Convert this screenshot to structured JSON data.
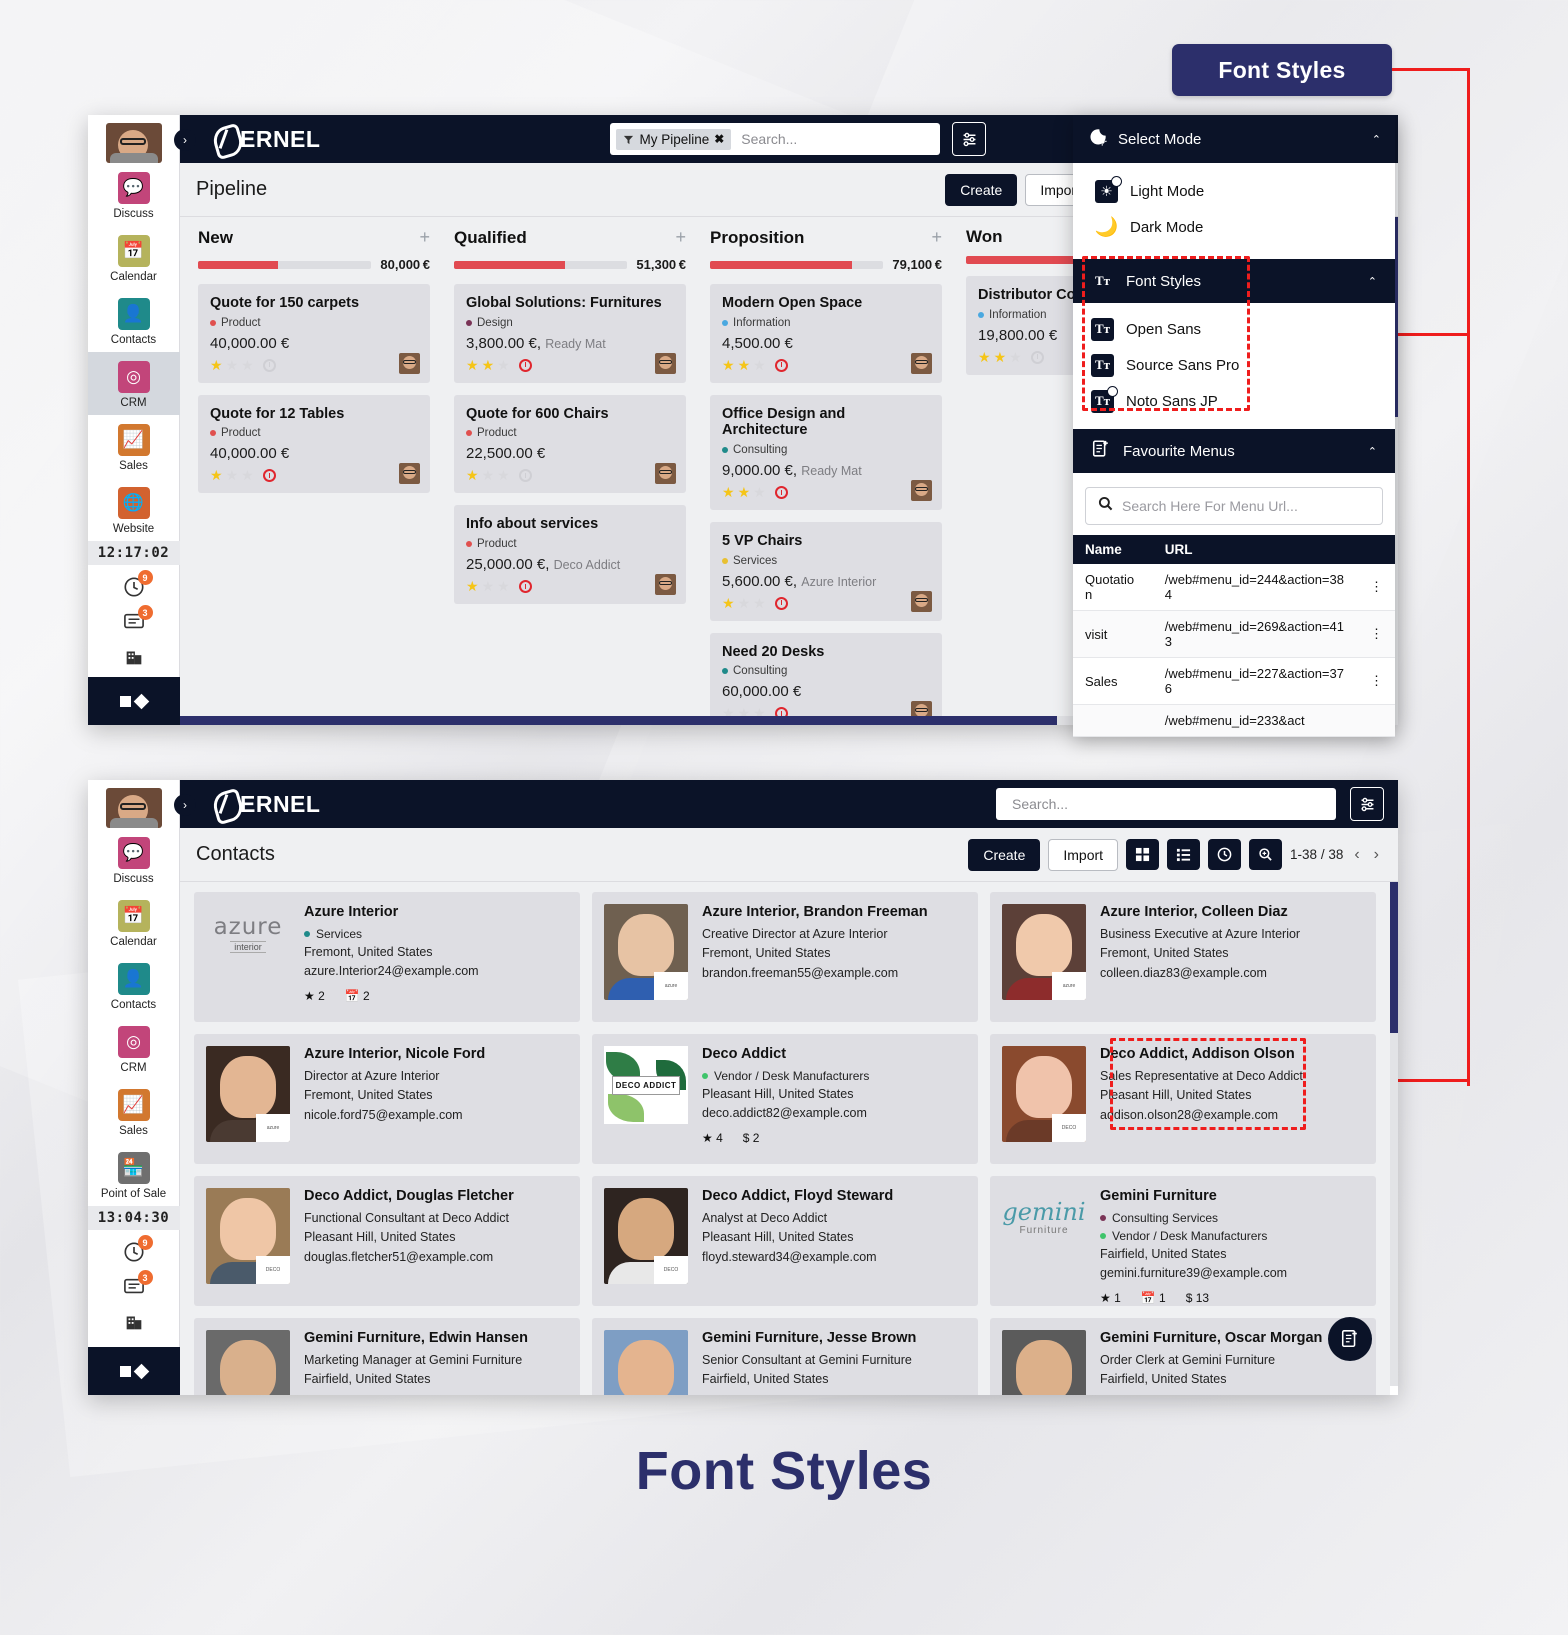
{
  "annotations": {
    "badge_label": "Font Styles",
    "bottom_caption": "Font Styles"
  },
  "window1": {
    "brand": "ERNEL",
    "page_title": "Pipeline",
    "search": {
      "facet": "My Pipeline",
      "facet_remove": "✖",
      "placeholder": "Search..."
    },
    "clock": "12:17:02",
    "buttons": {
      "create": "Create",
      "import": "Import"
    },
    "view_icons": [
      "kanban-view",
      "list-view",
      "calendar-view",
      "pivot-view",
      "graph-view",
      "activity-view",
      "map-view"
    ],
    "sidebar": [
      {
        "label": "Discuss",
        "color": "#c2457a",
        "glyph": "💬"
      },
      {
        "label": "Calendar",
        "color": "#b5b35c",
        "glyph": "📅"
      },
      {
        "label": "Contacts",
        "color": "#1f8a8a",
        "glyph": "👤"
      },
      {
        "label": "CRM",
        "color": "#c2457a",
        "glyph": "◎"
      },
      {
        "label": "Sales",
        "color": "#d2782f",
        "glyph": "📈"
      },
      {
        "label": "Website",
        "color": "#d2622f",
        "glyph": "🌐"
      }
    ],
    "badges": {
      "clock_count": "9",
      "chat_count": "3"
    },
    "columns": [
      {
        "name": "New",
        "amount": "80,000 €",
        "progress": 46,
        "cards": [
          {
            "title": "Quote for 150 carpets",
            "tag": "Product",
            "tag_color": "#e0504f",
            "amount": "40,000.00 €",
            "partner": "",
            "stars": 1,
            "clock": "mute"
          },
          {
            "title": "Quote for 12 Tables",
            "tag": "Product",
            "tag_color": "#e0504f",
            "amount": "40,000.00 €",
            "partner": "",
            "stars": 1,
            "clock": "red"
          }
        ]
      },
      {
        "name": "Qualified",
        "amount": "51,300 €",
        "progress": 64,
        "cards": [
          {
            "title": "Global Solutions: Furnitures",
            "tag": "Design",
            "tag_color": "#7a3356",
            "amount": "3,800.00 €",
            "partner": "Ready Mat",
            "stars": 2,
            "clock": "red"
          },
          {
            "title": "Quote for 600 Chairs",
            "tag": "Product",
            "tag_color": "#e0504f",
            "amount": "22,500.00 €",
            "partner": "",
            "stars": 1,
            "clock": "mute"
          },
          {
            "title": "Info about services",
            "tag": "Product",
            "tag_color": "#e0504f",
            "amount": "25,000.00 €",
            "partner": "Deco Addict",
            "stars": 1,
            "clock": "red"
          }
        ]
      },
      {
        "name": "Proposition",
        "amount": "79,100 €",
        "progress": 82,
        "cards": [
          {
            "title": "Modern Open Space",
            "tag": "Information",
            "tag_color": "#4aa8e0",
            "amount": "4,500.00 €",
            "partner": "",
            "stars": 2,
            "clock": "red"
          },
          {
            "title": "Office Design and Architecture",
            "tag": "Consulting",
            "tag_color": "#1f8a8a",
            "amount": "9,000.00 €",
            "partner": "Ready Mat",
            "stars": 2,
            "clock": "red"
          },
          {
            "title": "5 VP Chairs",
            "tag": "Services",
            "tag_color": "#e8c031",
            "amount": "5,600.00 €",
            "partner": "Azure Interior",
            "stars": 1,
            "clock": "red"
          },
          {
            "title": "Need 20 Desks",
            "tag": "Consulting",
            "tag_color": "#1f8a8a",
            "amount": "60,000.00 €",
            "partner": "",
            "stars": 0,
            "clock": "red"
          }
        ]
      },
      {
        "name": "Won",
        "amount": "",
        "progress": 100,
        "cards": [
          {
            "title": "Distributor Contract",
            "tag": "Information",
            "tag_color": "#4aa8e0",
            "amount": "19,800.00 €",
            "partner": "",
            "stars": 2,
            "clock": "mute"
          }
        ]
      }
    ]
  },
  "dropdown": {
    "header": {
      "label": "Select Mode",
      "caret": "⌃"
    },
    "mode_items": [
      {
        "label": "Light Mode",
        "icon": "sun-icon",
        "checked": true
      },
      {
        "label": "Dark Mode",
        "icon": "moon-icon",
        "checked": false
      }
    ],
    "font_section": {
      "label": "Font Styles",
      "caret": "⌃"
    },
    "fonts": [
      {
        "label": "Open Sans",
        "checked": false
      },
      {
        "label": "Source Sans Pro",
        "checked": false
      },
      {
        "label": "Noto Sans JP",
        "checked": true
      }
    ],
    "fav_section": {
      "label": "Favourite Menus",
      "caret": "⌃"
    },
    "fav_search_placeholder": "Search Here For Menu Url...",
    "fav_table": {
      "headers": [
        "Name",
        "URL"
      ],
      "rows": [
        {
          "name": "Quotation",
          "url": "/web#menu_id=244&action=384"
        },
        {
          "name": "visit",
          "url": "/web#menu_id=269&action=413"
        },
        {
          "name": "Sales",
          "url": "/web#menu_id=227&action=376"
        },
        {
          "name": "",
          "url": "/web#menu_id=233&act"
        }
      ]
    }
  },
  "window2": {
    "brand": "ERNEL",
    "page_title": "Contacts",
    "search": {
      "placeholder": "Search..."
    },
    "clock": "13:04:30",
    "buttons": {
      "create": "Create",
      "import": "Import"
    },
    "pager": "1-38 / 38",
    "sidebar": [
      {
        "label": "Discuss",
        "color": "#c2457a",
        "glyph": "💬"
      },
      {
        "label": "Calendar",
        "color": "#b5b35c",
        "glyph": "📅"
      },
      {
        "label": "Contacts",
        "color": "#1f8a8a",
        "glyph": "👤"
      },
      {
        "label": "CRM",
        "color": "#c2457a",
        "glyph": "◎"
      },
      {
        "label": "Sales",
        "color": "#d2782f",
        "glyph": "📈"
      },
      {
        "label": "Point of Sale",
        "color": "#6f6f6f",
        "glyph": "🏪"
      }
    ],
    "badges": {
      "clock_count": "9",
      "chat_count": "3"
    },
    "contacts": [
      {
        "name": "Azure Interior",
        "role": "",
        "tags": [
          {
            "text": "Services",
            "color": "#1f8a8a"
          }
        ],
        "city": "Fremont, United States",
        "email": "azure.Interior24@example.com",
        "stats": [
          {
            "icon": "star",
            "value": "2"
          },
          {
            "icon": "calendar",
            "value": "2"
          }
        ],
        "media": "azure-logo"
      },
      {
        "name": "Azure Interior, Brandon Freeman",
        "role": "Creative Director at Azure Interior",
        "tags": [],
        "city": "Fremont, United States",
        "email": "brandon.freeman55@example.com",
        "stats": [],
        "media": "photo-male-1"
      },
      {
        "name": "Azure Interior, Colleen Diaz",
        "role": "Business Executive at Azure Interior",
        "tags": [],
        "city": "Fremont, United States",
        "email": "colleen.diaz83@example.com",
        "stats": [],
        "media": "photo-female-1"
      },
      {
        "name": "Azure Interior, Nicole Ford",
        "role": "Director at Azure Interior",
        "tags": [],
        "city": "Fremont, United States",
        "email": "nicole.ford75@example.com",
        "stats": [],
        "media": "photo-female-2"
      },
      {
        "name": "Deco Addict",
        "role": "",
        "tags": [
          {
            "text": "Vendor / Desk Manufacturers",
            "color": "#3fc46b"
          }
        ],
        "city": "Pleasant Hill, United States",
        "email": "deco.addict82@example.com",
        "stats": [
          {
            "icon": "star",
            "value": "4"
          },
          {
            "icon": "dollar",
            "value": "2"
          }
        ],
        "media": "deco-logo"
      },
      {
        "name": "Deco Addict, Addison Olson",
        "role": "Sales Representative at Deco Addict",
        "tags": [],
        "city": "Pleasant Hill, United States",
        "email": "addison.olson28@example.com",
        "stats": [],
        "media": "photo-female-3",
        "highlight": true
      },
      {
        "name": "Deco Addict, Douglas Fletcher",
        "role": "Functional Consultant at Deco Addict",
        "tags": [],
        "city": "Pleasant Hill, United States",
        "email": "douglas.fletcher51@example.com",
        "stats": [],
        "media": "photo-male-2"
      },
      {
        "name": "Deco Addict, Floyd Steward",
        "role": "Analyst at Deco Addict",
        "tags": [],
        "city": "Pleasant Hill, United States",
        "email": "floyd.steward34@example.com",
        "stats": [],
        "media": "photo-male-3"
      },
      {
        "name": "Gemini Furniture",
        "role": "",
        "tags": [
          {
            "text": "Consulting Services",
            "color": "#7a3356"
          },
          {
            "text": "Vendor / Desk Manufacturers",
            "color": "#3fc46b"
          }
        ],
        "city": "Fairfield, United States",
        "email": "gemini.furniture39@example.com",
        "stats": [
          {
            "icon": "star",
            "value": "1"
          },
          {
            "icon": "calendar",
            "value": "1"
          },
          {
            "icon": "dollar",
            "value": "13"
          }
        ],
        "media": "gemini-logo"
      },
      {
        "name": "Gemini Furniture, Edwin Hansen",
        "role": "Marketing Manager at Gemini Furniture",
        "tags": [],
        "city": "Fairfield, United States",
        "email": "",
        "stats": [],
        "media": "photo-male-4"
      },
      {
        "name": "Gemini Furniture, Jesse Brown",
        "role": "Senior Consultant at Gemini Furniture",
        "tags": [],
        "city": "Fairfield, United States",
        "email": "",
        "stats": [],
        "media": "photo-male-5"
      },
      {
        "name": "Gemini Furniture, Oscar Morgan",
        "role": "Order Clerk at Gemini Furniture",
        "tags": [],
        "city": "Fairfield, United States",
        "email": "",
        "stats": [],
        "media": "photo-male-6"
      }
    ]
  }
}
